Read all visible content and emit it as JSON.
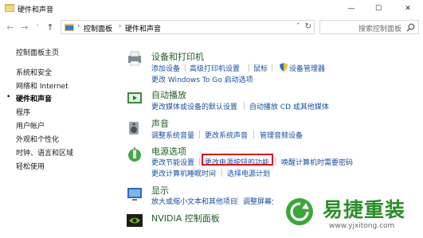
{
  "window": {
    "title": "硬件和声音",
    "controls": {
      "minimize": "—",
      "maximize": "☐",
      "close": "✕"
    }
  },
  "nav": {
    "back": "←",
    "forward": "→",
    "recent": "˅",
    "up": "↑",
    "breadcrumb": [
      "控制面板",
      "硬件和声音"
    ],
    "search_placeholder": "搜索控制面板"
  },
  "sidebar": {
    "items": [
      {
        "label": "控制面板主页",
        "active": false
      },
      {
        "label": "系统和安全",
        "active": false
      },
      {
        "label": "网络和 Internet",
        "active": false
      },
      {
        "label": "硬件和声音",
        "active": true
      },
      {
        "label": "程序",
        "active": false
      },
      {
        "label": "用户帐户",
        "active": false
      },
      {
        "label": "外观和个性化",
        "active": false
      },
      {
        "label": "时钟、语言和区域",
        "active": false
      },
      {
        "label": "轻松使用",
        "active": false
      }
    ]
  },
  "groups": {
    "devices": {
      "title": "设备和打印机",
      "links": [
        "添加设备",
        "高级打印机设置",
        "鼠标",
        "设备管理器",
        "更改 Windows To Go 启动选项"
      ]
    },
    "autoplay": {
      "title": "自动播放",
      "links": [
        "更改媒体或设备的默认设置",
        "自动播放 CD 或其他媒体"
      ]
    },
    "sound": {
      "title": "声音",
      "links": [
        "调整系统音量",
        "更改系统声音",
        "管理音频设备"
      ]
    },
    "power": {
      "title": "电源选项",
      "links": [
        "更改节能设置",
        "更改电源按钮的功能",
        "唤醒计算机时需要密码",
        "更改计算机睡眠时间",
        "选择电源计划"
      ]
    },
    "display": {
      "title": "显示",
      "links": [
        "放大或缩小文本和其他项目",
        "调整屏幕分辨率"
      ]
    },
    "nvidia": {
      "title": "NVIDIA 控制面板"
    }
  },
  "watermark": {
    "brand": "易捷重装",
    "url": "www.yjxitong.com"
  },
  "colors": {
    "link": "#1a4fa0",
    "group_title": "#1f5c26",
    "highlight": "#e0121b",
    "brand": "#2c8e2a"
  }
}
